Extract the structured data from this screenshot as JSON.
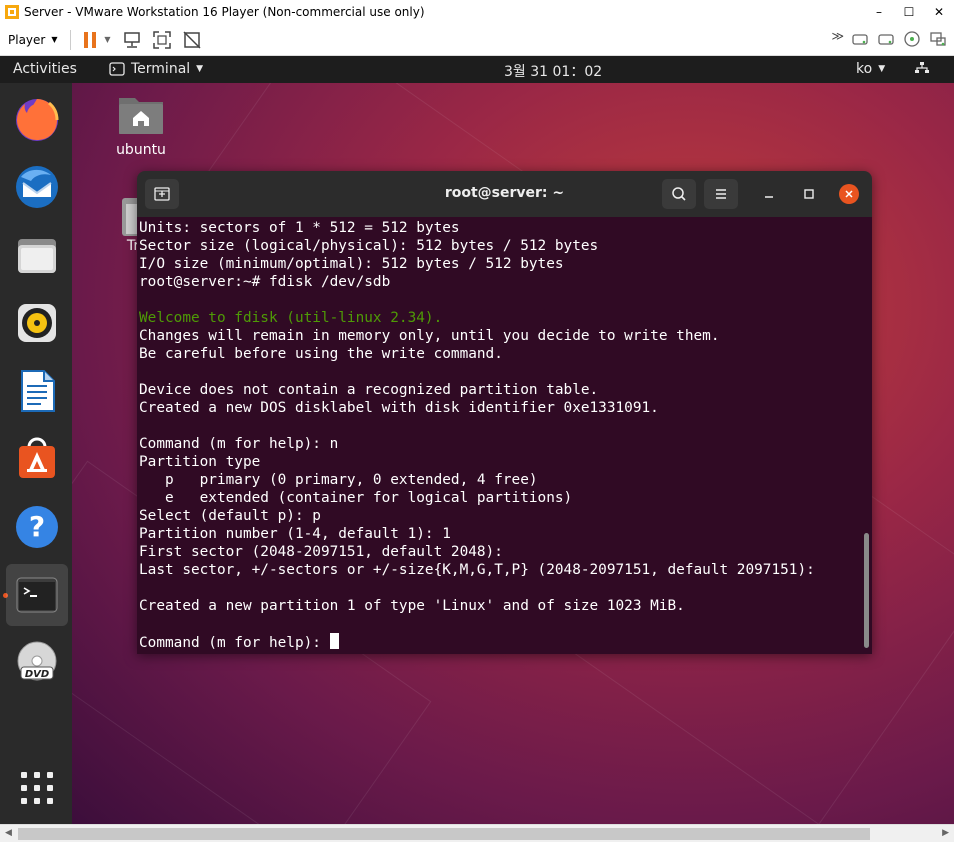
{
  "window": {
    "title": "Server - VMware Workstation 16 Player (Non-commercial use only)",
    "controls": [
      "–",
      "☐",
      "✕"
    ],
    "player_menu": "Player"
  },
  "topbar": {
    "activities": "Activities",
    "app_name": "Terminal",
    "clock": "3월 31  01：02",
    "lang": "ko"
  },
  "desktop": {
    "home_label": "ubuntu",
    "trash_label": "Tr"
  },
  "terminal": {
    "title": "root@server: ~",
    "lines": [
      {
        "text": "Units: sectors of 1 * 512 = 512 bytes",
        "green": false
      },
      {
        "text": "Sector size (logical/physical): 512 bytes / 512 bytes",
        "green": false
      },
      {
        "text": "I/O size (minimum/optimal): 512 bytes / 512 bytes",
        "green": false
      },
      {
        "text": "root@server:~# fdisk /dev/sdb",
        "green": false
      },
      {
        "text": "",
        "green": false
      },
      {
        "text": "Welcome to fdisk (util-linux 2.34).",
        "green": true
      },
      {
        "text": "Changes will remain in memory only, until you decide to write them.",
        "green": false
      },
      {
        "text": "Be careful before using the write command.",
        "green": false
      },
      {
        "text": "",
        "green": false
      },
      {
        "text": "Device does not contain a recognized partition table.",
        "green": false
      },
      {
        "text": "Created a new DOS disklabel with disk identifier 0xe1331091.",
        "green": false
      },
      {
        "text": "",
        "green": false
      },
      {
        "text": "Command (m for help): n",
        "green": false
      },
      {
        "text": "Partition type",
        "green": false
      },
      {
        "text": "   p   primary (0 primary, 0 extended, 4 free)",
        "green": false
      },
      {
        "text": "   e   extended (container for logical partitions)",
        "green": false
      },
      {
        "text": "Select (default p): p",
        "green": false
      },
      {
        "text": "Partition number (1-4, default 1): 1",
        "green": false
      },
      {
        "text": "First sector (2048-2097151, default 2048):",
        "green": false
      },
      {
        "text": "Last sector, +/-sectors or +/-size{K,M,G,T,P} (2048-2097151, default 2097151):",
        "green": false
      },
      {
        "text": "",
        "green": false
      },
      {
        "text": "Created a new partition 1 of type 'Linux' and of size 1023 MiB.",
        "green": false
      },
      {
        "text": "",
        "green": false
      }
    ],
    "prompt": "Command (m for help): "
  },
  "dock": {
    "items": [
      "firefox-icon",
      "thunderbird-icon",
      "files-icon",
      "rhythmbox-icon",
      "libreoffice-writer-icon",
      "software-icon",
      "help-icon",
      "terminal-icon",
      "dvd-icon"
    ]
  },
  "colors": {
    "term_bg": "#300a24",
    "term_green": "#4e9a06",
    "accent": "#e95420"
  }
}
